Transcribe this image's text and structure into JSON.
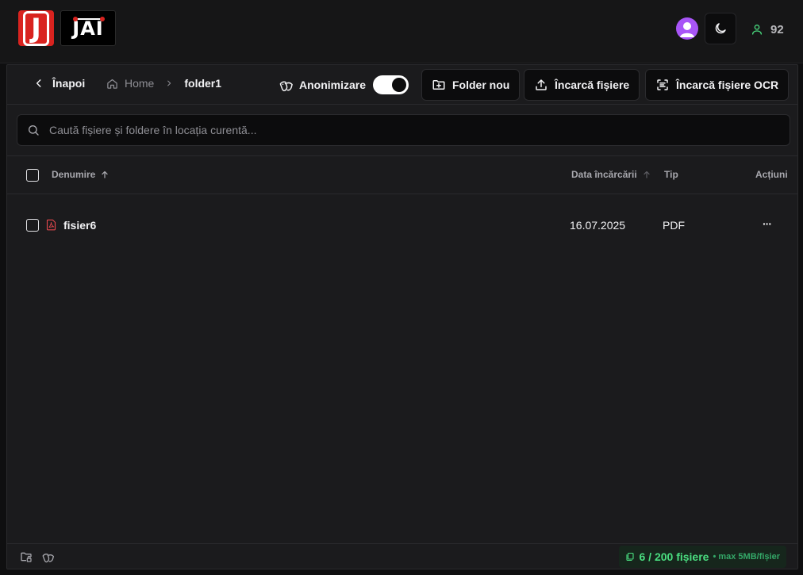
{
  "brand": {
    "logo_letter": "J",
    "logo_text": "JAI"
  },
  "header": {
    "user_count": "92"
  },
  "toolbar": {
    "back_label": "Înapoi",
    "breadcrumb": {
      "home": "Home",
      "current": "folder1"
    },
    "anonymize_label": "Anonimizare",
    "anonymize_on": true,
    "new_folder_label": "Folder nou",
    "upload_label": "Încarcă fișiere",
    "upload_ocr_label": "Încarcă fișiere OCR"
  },
  "search": {
    "placeholder": "Caută fișiere și foldere în locația curentă...",
    "value": ""
  },
  "table": {
    "columns": {
      "name": "Denumire",
      "date": "Data încărcării",
      "type": "Tip",
      "actions": "Acțiuni"
    },
    "rows": [
      {
        "name": "fisier6",
        "date": "16.07.2025",
        "type": "PDF",
        "actions": "···"
      }
    ]
  },
  "footer": {
    "quota": "6 / 200 fișiere",
    "quota_note": "• max 5MB/fișier"
  },
  "colors": {
    "accent_red": "#d9231f",
    "avatar": "#a855f7",
    "quota_green": "#4ade80",
    "pdf_red": "#e5484d"
  }
}
